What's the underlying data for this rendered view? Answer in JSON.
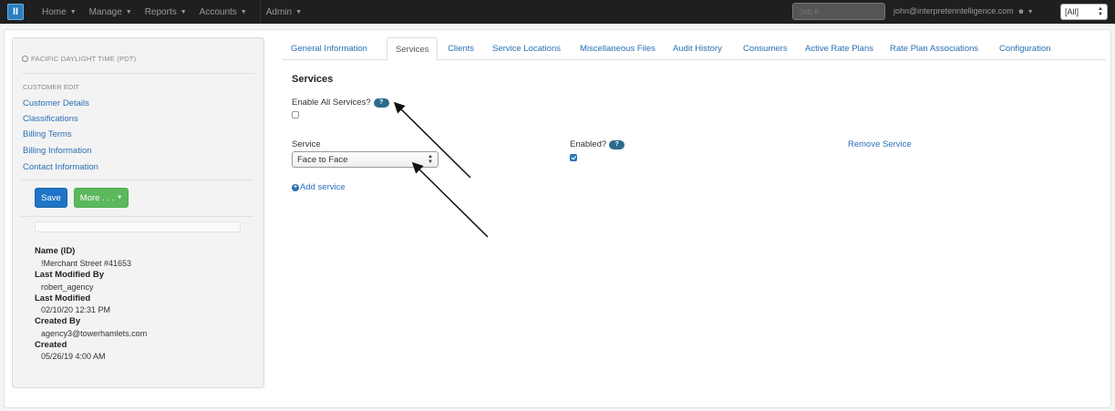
{
  "nav": {
    "logo_text": "II",
    "items": [
      {
        "label": "Home"
      },
      {
        "label": "Manage"
      },
      {
        "label": "Reports"
      },
      {
        "label": "Accounts"
      },
      {
        "label": "Admin"
      }
    ],
    "job_placeholder": "Job #",
    "user_email": "john@interpreterintelligence.com",
    "scope_select": "[All]"
  },
  "sidebar": {
    "timezone": "PACIFIC DAYLIGHT TIME (PDT)",
    "section_heading": "CUSTOMER EDIT",
    "links": [
      "Customer Details",
      "Classifications",
      "Billing Terms",
      "Billing Information",
      "Contact Information"
    ],
    "save_label": "Save",
    "more_label": "More . . .",
    "meta": {
      "name_label": "Name (ID)",
      "name_value": "!Merchant Street #41653",
      "last_modified_by_label": "Last Modified By",
      "last_modified_by_value": "robert_agency",
      "last_modified_label": "Last Modified",
      "last_modified_value": "02/10/20 12:31 PM",
      "created_by_label": "Created By",
      "created_by_value": "agency3@towerhamlets.com",
      "created_label": "Created",
      "created_value": "05/26/19 4:00 AM"
    }
  },
  "tabs": [
    "General Information",
    "Services",
    "Clients",
    "Service Locations",
    "Miscellaneous Files",
    "Audit History",
    "Consumers",
    "Active Rate Plans",
    "Rate Plan Associations",
    "Configuration"
  ],
  "active_tab": "Services",
  "content": {
    "title": "Services",
    "enable_all_label": "Enable All Services?",
    "help_text": "?",
    "enable_all_checked": false,
    "service_col_label": "Service",
    "enabled_col_label": "Enabled?",
    "service_value": "Face to Face",
    "service_enabled": true,
    "remove_label": "Remove Service",
    "add_label": "Add service"
  },
  "colors": {
    "navbar_bg": "#1f1f1f",
    "link": "#2a6fb3",
    "save_btn": "#1e74c6",
    "more_btn": "#5cb85c",
    "help_badge": "#2d6b8d"
  }
}
